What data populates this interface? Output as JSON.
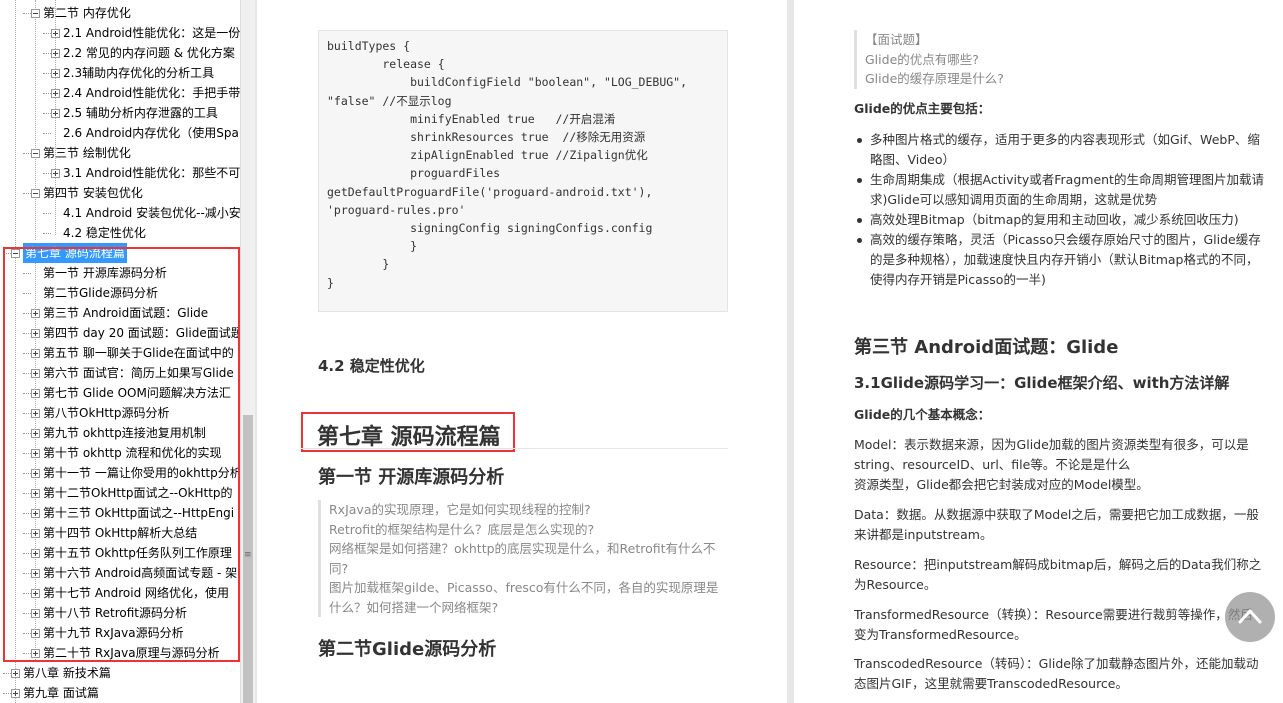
{
  "nav": {
    "items": [
      {
        "label": "第二节 内存优化",
        "expander": "minus",
        "indent": 2
      },
      {
        "label": "2.1 Android性能优化：这是一份",
        "expander": "plus",
        "indent": 3
      },
      {
        "label": "2.2 常见的内存问题 & 优化方案",
        "expander": "plus",
        "indent": 3
      },
      {
        "label": "2.3辅助内存优化的分析工具",
        "expander": "plus",
        "indent": 3
      },
      {
        "label": "2.4 Android性能优化：手把手带",
        "expander": "plus",
        "indent": 3
      },
      {
        "label": "2.5 辅助分析内存泄露的工具",
        "expander": "plus",
        "indent": 3
      },
      {
        "label": "2.6 Android内存优化（使用Spa",
        "expander": "none",
        "indent": 3
      },
      {
        "label": "第三节 绘制优化",
        "expander": "minus",
        "indent": 2
      },
      {
        "label": "3.1 Android性能优化：那些不可",
        "expander": "plus",
        "indent": 3
      },
      {
        "label": "第四节 安装包优化",
        "expander": "minus",
        "indent": 2
      },
      {
        "label": "4.1 Android 安装包优化--减小安",
        "expander": "none",
        "indent": 3
      },
      {
        "label": "4.2 稳定性优化",
        "expander": "none",
        "indent": 3
      },
      {
        "label": "第七章 源码流程篇",
        "expander": "minus",
        "indent": 1,
        "selected": true
      },
      {
        "label": "第一节 开源库源码分析",
        "expander": "none",
        "indent": 2
      },
      {
        "label": "第二节Glide源码分析",
        "expander": "none",
        "indent": 2
      },
      {
        "label": "第三节 Android面试题：Glide",
        "expander": "plus",
        "indent": 2
      },
      {
        "label": "第四节 day 20 面试题：Glide面试题",
        "expander": "plus",
        "indent": 2
      },
      {
        "label": "第五节 聊一聊关于Glide在面试中的",
        "expander": "plus",
        "indent": 2
      },
      {
        "label": "第六节 面试官：简历上如果写Glide",
        "expander": "plus",
        "indent": 2
      },
      {
        "label": "第七节 Glide OOM问题解决方法汇",
        "expander": "plus",
        "indent": 2
      },
      {
        "label": "第八节OkHttp源码分析",
        "expander": "plus",
        "indent": 2
      },
      {
        "label": "第九节 okhttp连接池复用机制",
        "expander": "plus",
        "indent": 2
      },
      {
        "label": "第十节 okhttp 流程和优化的实现",
        "expander": "plus",
        "indent": 2
      },
      {
        "label": "第十一节 一篇让你受用的okhttp分析",
        "expander": "plus",
        "indent": 2
      },
      {
        "label": "第十二节OkHttp面试之--OkHttp的",
        "expander": "plus",
        "indent": 2
      },
      {
        "label": "第十三节 OkHttp面试之--HttpEngi",
        "expander": "plus",
        "indent": 2
      },
      {
        "label": "第十四节 OkHttp解析大总结",
        "expander": "plus",
        "indent": 2
      },
      {
        "label": "第十五节 Okhttp任务队列工作原理",
        "expander": "plus",
        "indent": 2
      },
      {
        "label": "第十六节 Android高频面试专题 - 架",
        "expander": "plus",
        "indent": 2
      },
      {
        "label": "第十七节 Android 网络优化，使用",
        "expander": "plus",
        "indent": 2
      },
      {
        "label": "第十八节 Retrofit源码分析",
        "expander": "plus",
        "indent": 2
      },
      {
        "label": "第十九节 RxJava源码分析",
        "expander": "plus",
        "indent": 2
      },
      {
        "label": "第二十节 RxJava原理与源码分析",
        "expander": "plus",
        "indent": 2
      },
      {
        "label": "第八章 新技术篇",
        "expander": "plus",
        "indent": 1
      },
      {
        "label": "第九章 面试篇",
        "expander": "plus",
        "indent": 1
      }
    ]
  },
  "left_page": {
    "code_lines": [
      "buildTypes {",
      "        release {",
      "            buildConfigField \"boolean\", \"LOG_DEBUG\",",
      "\"false\" //不显示log",
      "            minifyEnabled true   //开启混淆",
      "            shrinkResources true  //移除无用资源",
      "            zipAlignEnabled true //Zipalign优化",
      "            proguardFiles",
      "getDefaultProguardFile('proguard-android.txt'),",
      "'proguard-rules.pro'",
      "            signingConfig signingConfigs.config",
      "            }",
      "        }",
      "}"
    ],
    "heading_42": "4.2 稳定性优化",
    "chapter_title": "第七章 源码流程篇",
    "section1_title": "第一节 开源库源码分析",
    "quote_lines": [
      "RxJava的实现原理，它是如何实现线程的控制?",
      "Retrofit的框架结构是什么？底层是怎么实现的?",
      "网络框架是如何搭建？okhttp的底层实现是什么，和Retrofit有什么不",
      "同?",
      "图片加载框架gilde、Picasso、fresco有什么不同，各自的实现原理是",
      "什么？如何搭建一个网络框架?"
    ],
    "section2_title": "第二节Glide源码分析"
  },
  "right_page": {
    "quote_lines": [
      "【面试题】",
      "Glide的优点有哪些?",
      "Glide的缓存原理是什么?"
    ],
    "advantages_heading": "Glide的优点主要包括：",
    "advantages": [
      "多种图片格式的缓存，适用于更多的内容表现形式（如Gif、WebP、缩略图、Video）",
      "生命周期集成（根据Activity或者Fragment的生命周期管理图片加载请求)Glide可以感知调用页面的生命周期，这就是优势",
      "高效处理Bitmap（bitmap的复用和主动回收，减少系统回收压力)",
      "高效的缓存策略，灵活（Picasso只会缓存原始尺寸的图片，Glide缓存的是多种规格），加载速度快且内存开销小（默认Bitmap格式的不同，使得内存开销是Picasso的一半)"
    ],
    "section3_title": "第三节 Android面试题：Glide",
    "sub31_title": "3.1Glide源码学习一：Glide框架介绍、with方法详解",
    "concepts_heading": "Glide的几个基本概念：",
    "para_model_lines": [
      "Model：表示数据来源，因为Glide加载的图片资源类型有很多，可以是",
      "string、resourceID、url、file等。不论是是什么",
      "资源类型，Glide都会把它封装成对应的Model模型。"
    ],
    "para_data_lines": [
      "Data：数据。从数据源中获取了Model之后，需要把它加工成数据，一般",
      "来讲都是inputstream。"
    ],
    "para_resource_lines": [
      "Resource：把inputstream解码成bitmap后，解码之后的Data我们称之",
      "为Resource。"
    ],
    "para_transformed_lines": [
      "TransformedResource（转换）：Resource需要进行裁剪等操作，然后",
      "变为TransformedResource。"
    ],
    "para_transcoded_lines": [
      "TranscodedResource（转码）：Glide除了加载静态图片外，还能加载动",
      "态图片GIF，这里就需要TranscodedResource。"
    ]
  },
  "scroll_top_icon": "chevron-up-icon",
  "colors": {
    "highlight_border": "#ee3333",
    "selection": "#3399ff",
    "quote_text": "#888888"
  }
}
